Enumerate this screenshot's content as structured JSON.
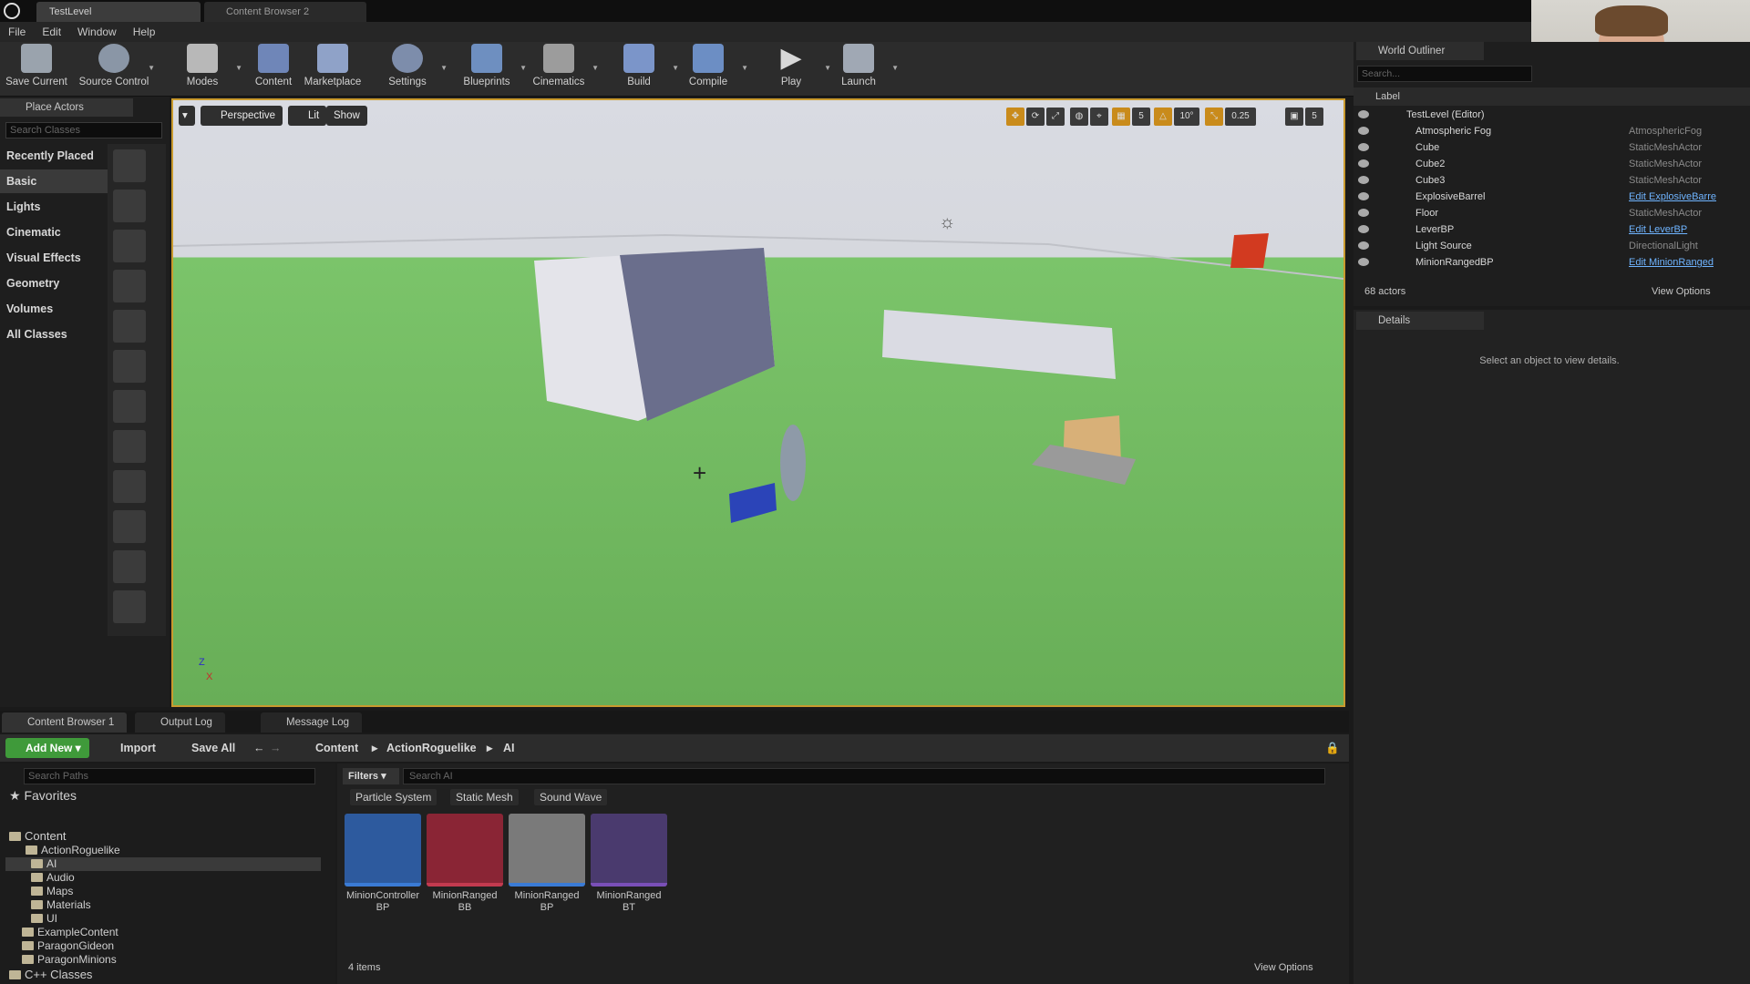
{
  "window": {
    "tabs": [
      "TestLevel",
      "Content Browser 2"
    ],
    "menus": [
      "File",
      "Edit",
      "Window",
      "Help"
    ]
  },
  "toolbar": [
    {
      "label": "Save Current",
      "icon": "save-icon"
    },
    {
      "label": "Source Control",
      "icon": "source-control-icon"
    },
    {
      "label": "Modes",
      "icon": "modes-icon"
    },
    {
      "label": "Content",
      "icon": "content-icon"
    },
    {
      "label": "Marketplace",
      "icon": "marketplace-icon"
    },
    {
      "label": "Settings",
      "icon": "settings-icon"
    },
    {
      "label": "Blueprints",
      "icon": "blueprints-icon"
    },
    {
      "label": "Cinematics",
      "icon": "cinematics-icon"
    },
    {
      "label": "Build",
      "icon": "build-icon"
    },
    {
      "label": "Compile",
      "icon": "compile-icon"
    },
    {
      "label": "Play",
      "icon": "play-icon"
    },
    {
      "label": "Launch",
      "icon": "launch-icon"
    }
  ],
  "place_actors": {
    "title": "Place Actors",
    "search_placeholder": "Search Classes",
    "categories": [
      "Recently Placed",
      "Basic",
      "Lights",
      "Cinematic",
      "Visual Effects",
      "Geometry",
      "Volumes",
      "All Classes"
    ],
    "selected": "Basic"
  },
  "viewport": {
    "perspective": "Perspective",
    "lit": "Lit",
    "show": "Show",
    "grid_snap": "5",
    "rotation_snap": "10°",
    "scale_snap": "0.25",
    "camera_speed": "5"
  },
  "outliner": {
    "title": "World Outliner",
    "search_placeholder": "Search...",
    "label_header": "Label",
    "rows": [
      {
        "name": "TestLevel (Editor)",
        "type": ""
      },
      {
        "name": "Atmospheric Fog",
        "type": "AtmosphericFog"
      },
      {
        "name": "Cube",
        "type": "StaticMeshActor"
      },
      {
        "name": "Cube2",
        "type": "StaticMeshActor"
      },
      {
        "name": "Cube3",
        "type": "StaticMeshActor"
      },
      {
        "name": "ExplosiveBarrel",
        "type": "Edit ExplosiveBarre"
      },
      {
        "name": "Floor",
        "type": "StaticMeshActor"
      },
      {
        "name": "LeverBP",
        "type": "Edit LeverBP"
      },
      {
        "name": "Light Source",
        "type": "DirectionalLight"
      },
      {
        "name": "MinionRangedBP",
        "type": "Edit MinionRanged"
      }
    ],
    "actor_count": "68 actors",
    "view_options": "View Options"
  },
  "details": {
    "title": "Details",
    "empty_message": "Select an object to view details."
  },
  "content_browser": {
    "tabs": [
      "Content Browser 1",
      "Output Log",
      "Message Log"
    ],
    "add_new": "Add New",
    "import": "Import",
    "save_all": "Save All",
    "breadcrumb": [
      "Content",
      "ActionRoguelike",
      "AI"
    ],
    "search_paths_placeholder": "Search Paths",
    "favorites": "Favorites",
    "tree": [
      {
        "name": "Content",
        "level": 0
      },
      {
        "name": "ActionRoguelike",
        "level": 1
      },
      {
        "name": "AI",
        "level": 2
      },
      {
        "name": "Audio",
        "level": 2
      },
      {
        "name": "Maps",
        "level": 2
      },
      {
        "name": "Materials",
        "level": 2
      },
      {
        "name": "UI",
        "level": 2
      },
      {
        "name": "ExampleContent",
        "level": 1
      },
      {
        "name": "ParagonGideon",
        "level": 1
      },
      {
        "name": "ParagonMinions",
        "level": 1
      },
      {
        "name": "C++ Classes",
        "level": 0
      }
    ],
    "filters": "Filters",
    "search_placeholder": "Search AI",
    "filter_chips": [
      "Particle System",
      "Static Mesh",
      "Sound Wave"
    ],
    "assets": [
      {
        "line1": "MinionController",
        "line2": "BP",
        "color": "#2d5a9e",
        "bar": "#3a7bd5"
      },
      {
        "line1": "MinionRanged",
        "line2": "BB",
        "color": "#8a2535",
        "bar": "#c23a4f"
      },
      {
        "line1": "MinionRanged",
        "line2": "BP",
        "color": "#7a7a7a",
        "bar": "#3a7bd5"
      },
      {
        "line1": "MinionRanged",
        "line2": "BT",
        "color": "#4a3a6e",
        "bar": "#7a4fb8"
      }
    ],
    "item_count": "4 items",
    "view_options": "View Options"
  }
}
